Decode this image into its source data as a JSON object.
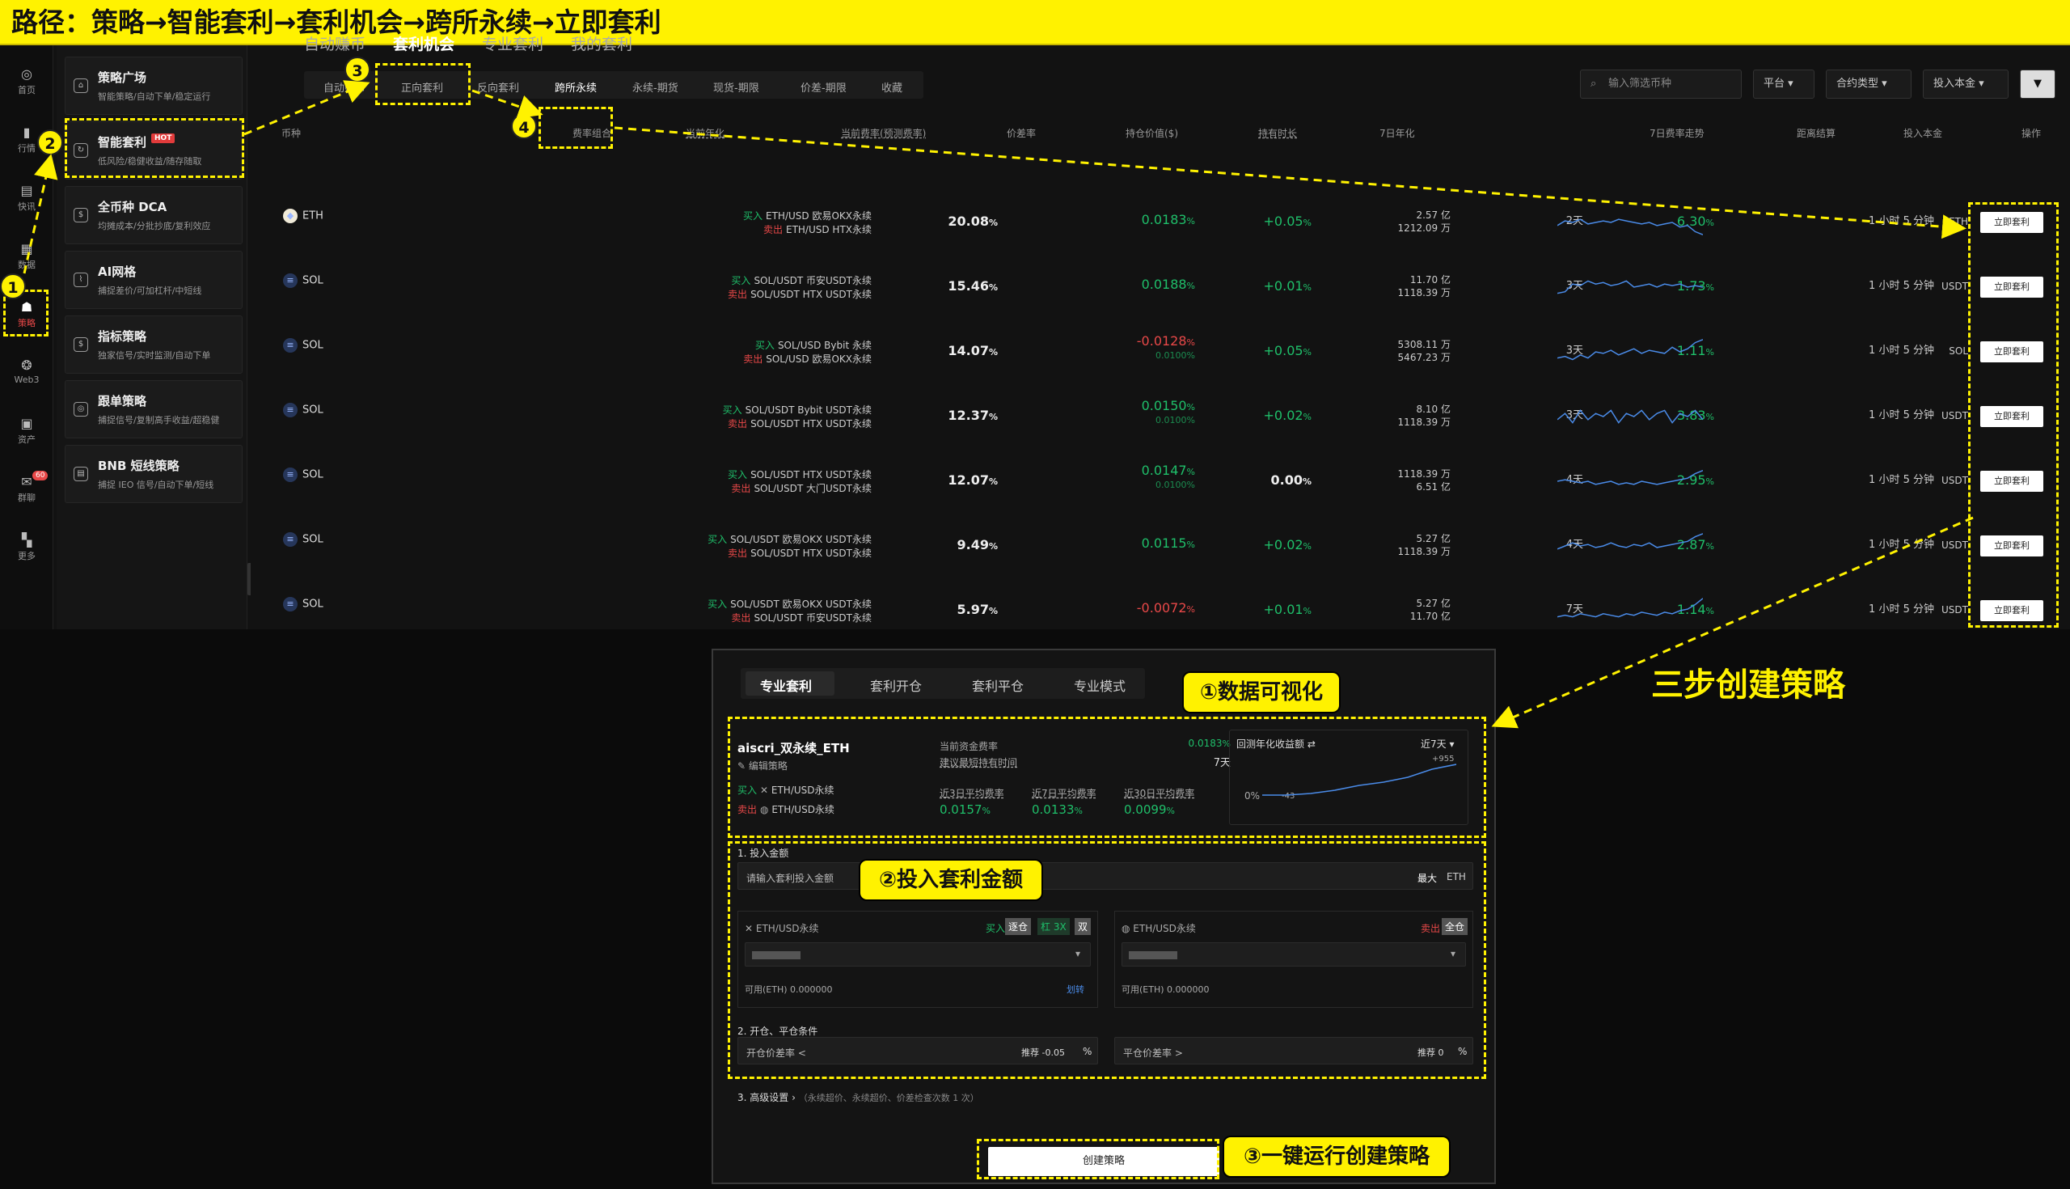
{
  "banner": {
    "text": "路径：策略→智能套利→套利机会→跨所永续→立即套利"
  },
  "leftnav": {
    "items": [
      {
        "label": "首页",
        "icon": "home-icon"
      },
      {
        "label": "行情",
        "icon": "chart-bars-icon"
      },
      {
        "label": "快讯",
        "icon": "news-icon"
      },
      {
        "label": "数据",
        "icon": "data-icon"
      },
      {
        "label": "策略",
        "icon": "robot-icon"
      },
      {
        "label": "Web3",
        "icon": "web3-icon"
      },
      {
        "label": "资产",
        "icon": "wallet-icon"
      },
      {
        "label": "群聊",
        "icon": "chat-icon",
        "badge": "60"
      },
      {
        "label": "更多",
        "icon": "grid-icon"
      }
    ]
  },
  "strategies": [
    {
      "title": "策略广场",
      "sub": "智能策略/自动下单/稳定运行"
    },
    {
      "title": "智能套利",
      "hot": "HOT",
      "sub": "低风险/稳健收益/随存随取"
    },
    {
      "title": "全币种 DCA",
      "sub": "均摊成本/分批抄底/复利效应"
    },
    {
      "title": "AI网格",
      "sub": "捕捉差价/可加杠杆/中短线"
    },
    {
      "title": "指标策略",
      "sub": "独家信号/实时监测/自动下单"
    },
    {
      "title": "跟单策略",
      "sub": "捕捉信号/复制高手收益/超稳健"
    },
    {
      "title": "BNB 短线策略",
      "sub": "捕捉 IEO 信号/自动下单/短线"
    }
  ],
  "tabs": [
    "自动赚币",
    "套利机会",
    "专业套利",
    "我的套利"
  ],
  "subtabs": [
    "自动赚币",
    "正向套利",
    "反向套利",
    "跨所永续",
    "永续-期货",
    "现货-期限",
    "价差-期限",
    "收藏"
  ],
  "search": {
    "placeholder": "输入筛选币种"
  },
  "filters": [
    "平台",
    "合约类型",
    "投入本金"
  ],
  "columns": [
    "币种",
    "费率组合",
    "当前年化",
    "当前费率(预测费率)",
    "价差率",
    "持仓价值($)",
    "持有时长",
    "7日年化",
    "7日费率走势",
    "距离结算",
    "投入本金",
    "操作"
  ],
  "rows": [
    {
      "coin": "ETH",
      "buy": "ETH/USD 欧易OKX永续",
      "sell": "ETH/USD HTX永续",
      "apy": "20.08",
      "rate": "0.0183",
      "pred": "",
      "rate_neg": false,
      "spread": "+0.05",
      "pos1": "2.57 亿",
      "pos2": "1212.09 万",
      "days": "2天",
      "apy7": "6.30",
      "settle": "1 小时 5 分钟",
      "cap": "ETH",
      "btn": "立即套利",
      "spark": [
        0.4,
        0.55,
        0.5,
        0.6,
        0.45,
        0.5,
        0.55,
        0.5,
        0.6,
        0.55,
        0.5,
        0.45,
        0.5,
        0.4,
        0.45,
        0.5,
        0.35,
        0.4,
        0.2,
        0.1
      ]
    },
    {
      "coin": "SOL",
      "buy": "SOL/USDT 币安USDT永续",
      "sell": "SOL/USDT HTX USDT永续",
      "apy": "15.46",
      "rate": "0.0188",
      "pred": "",
      "rate_neg": false,
      "spread": "+0.01",
      "pos1": "11.70 亿",
      "pos2": "1118.39 万",
      "days": "3天",
      "apy7": "1.73",
      "settle": "1 小时 5 分钟",
      "cap": "USDT",
      "btn": "立即套利",
      "spark": [
        0.3,
        0.35,
        0.6,
        0.55,
        0.7,
        0.6,
        0.65,
        0.55,
        0.6,
        0.7,
        0.5,
        0.55,
        0.6,
        0.5,
        0.6,
        0.55,
        0.6,
        0.5,
        0.55,
        0.5
      ]
    },
    {
      "coin": "SOL",
      "buy": "SOL/USD Bybit 永续",
      "sell": "SOL/USD 欧易OKX永续",
      "apy": "14.07",
      "rate": "-0.0128",
      "pred": "0.0100",
      "rate_neg": true,
      "spread": "+0.05",
      "pos1": "5308.11 万",
      "pos2": "5467.23 万",
      "days": "3天",
      "apy7": "1.11",
      "settle": "1 小时 5 分钟",
      "cap": "SOL",
      "btn": "立即套利",
      "spark": [
        0.3,
        0.35,
        0.25,
        0.4,
        0.3,
        0.5,
        0.45,
        0.55,
        0.4,
        0.5,
        0.6,
        0.45,
        0.55,
        0.5,
        0.45,
        0.65,
        0.5,
        0.6,
        0.8,
        0.9
      ]
    },
    {
      "coin": "SOL",
      "buy": "SOL/USDT Bybit USDT永续",
      "sell": "SOL/USDT HTX USDT永续",
      "apy": "12.37",
      "rate": "0.0150",
      "pred": "0.0100",
      "rate_neg": false,
      "spread": "+0.02",
      "pos1": "8.10 亿",
      "pos2": "1118.39 万",
      "days": "3天",
      "apy7": "3.83",
      "settle": "1 小时 5 分钟",
      "cap": "USDT",
      "btn": "立即套利",
      "spark": [
        0.4,
        0.6,
        0.3,
        0.7,
        0.4,
        0.6,
        0.5,
        0.7,
        0.3,
        0.6,
        0.5,
        0.7,
        0.4,
        0.6,
        0.7,
        0.3,
        0.6,
        0.5,
        0.7,
        0.4
      ]
    },
    {
      "coin": "SOL",
      "buy": "SOL/USDT HTX USDT永续",
      "sell": "SOL/USDT 大门USDT永续",
      "apy": "12.07",
      "rate": "0.0147",
      "pred": "0.0100",
      "rate_neg": false,
      "spread": "0.00",
      "pos1": "1118.39 万",
      "pos2": "6.51 亿",
      "days": "4天",
      "apy7": "2.95",
      "settle": "1 小时 5 分钟",
      "cap": "USDT",
      "btn": "立即套利",
      "spark": [
        0.5,
        0.55,
        0.5,
        0.45,
        0.5,
        0.4,
        0.45,
        0.5,
        0.4,
        0.45,
        0.4,
        0.5,
        0.45,
        0.4,
        0.45,
        0.5,
        0.55,
        0.6,
        0.75,
        0.85
      ]
    },
    {
      "coin": "SOL",
      "buy": "SOL/USDT 欧易OKX USDT永续",
      "sell": "SOL/USDT HTX USDT永续",
      "apy": "9.49",
      "rate": "0.0115",
      "pred": "",
      "rate_neg": false,
      "spread": "+0.02",
      "pos1": "5.27 亿",
      "pos2": "1118.39 万",
      "days": "4天",
      "apy7": "2.87",
      "settle": "1 小时 5 分钟",
      "cap": "USDT",
      "btn": "立即套利",
      "spark": [
        0.4,
        0.5,
        0.6,
        0.5,
        0.55,
        0.45,
        0.5,
        0.6,
        0.5,
        0.45,
        0.55,
        0.5,
        0.6,
        0.45,
        0.5,
        0.55,
        0.6,
        0.65,
        0.8,
        0.9
      ]
    },
    {
      "coin": "SOL",
      "buy": "SOL/USDT 欧易OKX USDT永续",
      "sell": "SOL/USDT 币安USDT永续",
      "apy": "5.97",
      "rate": "-0.0072",
      "pred": "",
      "rate_neg": true,
      "spread": "+0.01",
      "pos1": "5.27 亿",
      "pos2": "11.70 亿",
      "days": "7天",
      "apy7": "1.14",
      "settle": "1 小时 5 分钟",
      "cap": "USDT",
      "btn": "立即套利",
      "spark": [
        0.3,
        0.35,
        0.3,
        0.4,
        0.35,
        0.3,
        0.4,
        0.35,
        0.3,
        0.4,
        0.35,
        0.45,
        0.4,
        0.35,
        0.45,
        0.4,
        0.5,
        0.55,
        0.7,
        0.9
      ]
    }
  ],
  "pct": "%",
  "annotations": {
    "steps": [
      "1",
      "2",
      "3",
      "4"
    ],
    "c1": "①数据可视化",
    "c2": "②投入套利金额",
    "c3": "③一键运行创建策略",
    "big": "三步创建策略"
  },
  "dialog": {
    "tabs": [
      "专业套利",
      "套利开仓",
      "套利平仓",
      "专业模式"
    ],
    "name": "aiscri_双永续_ETH",
    "edit": "编辑策略",
    "buy_label": "买入",
    "sell_label": "卖出",
    "pair": "ETH/USD永续",
    "cur_rate_label": "当前资金费率",
    "cur_rate": "0.0183",
    "hold_label": "建议最短持有时间",
    "hold": "7天",
    "avg3_label": "近3日平均费率",
    "avg3": "0.0157",
    "avg7_label": "近7日平均费率",
    "avg7": "0.0133",
    "avg30_label": "近30日平均费率",
    "avg30": "0.0099",
    "chart_title": "回测年化收益额 ⇄",
    "chart_range": "近7天",
    "chart_zero": "0%",
    "chart_low": "-43",
    "chart_high": "+955",
    "sec1": "1. 投入金额",
    "amount_placeholder": "请输入套利投入金额",
    "max": "最大",
    "max_unit": "ETH",
    "left_pair": "ETH/USD永续",
    "right_pair": "ETH/USD永续",
    "mode_cross": "逐仓",
    "mode_lev": "杠 3X",
    "mode_dual": "双",
    "mode_full": "全仓",
    "avail_l": "可用(ETH) 0.000000",
    "transfer": "划转",
    "avail_r": "可用(ETH) 0.000000",
    "sec2": "2. 开仓、平仓条件",
    "open_label": "开仓价差率 <",
    "open_hint": "推荐 -0.05",
    "close_label": "平仓价差率 >",
    "close_hint": "推荐 0",
    "sec3": "3. 高级设置",
    "sec3_note": "（永续超价、永续超价、价差检查次数 1 次）",
    "create": "创建策略"
  },
  "colors": {
    "yellow": "#fff200",
    "green": "#1fbf6a",
    "red": "#e84848",
    "line": "#4a8be8"
  }
}
